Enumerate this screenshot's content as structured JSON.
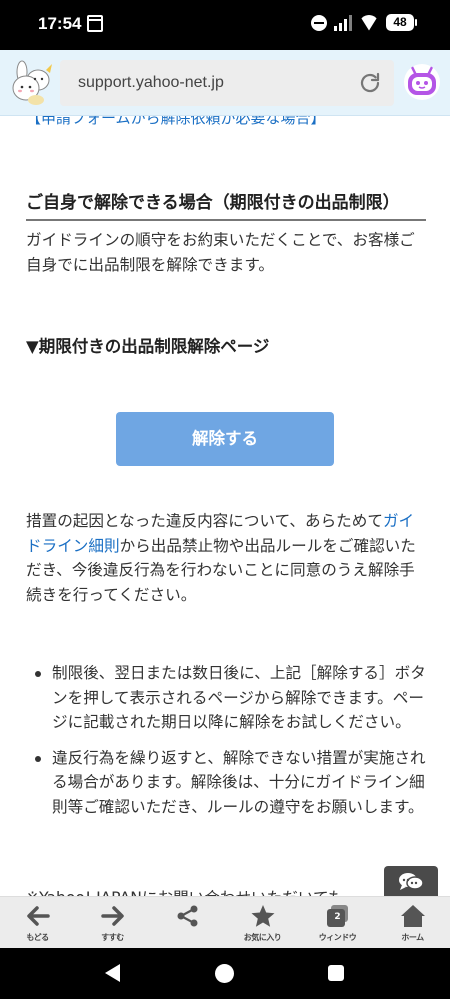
{
  "status": {
    "time": "17:54",
    "battery": "48",
    "icons": [
      "calendar-icon",
      "dnd-icon",
      "signal-icon",
      "wifi-icon",
      "battery-icon"
    ]
  },
  "browser": {
    "url": "support.yahoo-net.jp"
  },
  "content": {
    "cut_link": "【申請フォームから解除依頼が必要な場合】",
    "section_heading": "ご自身で解除できる場合（期限付きの出品制限）",
    "paragraph1": "ガイドラインの順守をお約束いただくことで、お客様ご自身でに出品制限を解除できます。",
    "sub_heading": "▼期限付きの出品制限解除ページ",
    "release_button": "解除する",
    "paragraph2_before": "措置の起因となった違反内容について、あらためて",
    "paragraph2_link": "ガイドライン細則",
    "paragraph2_after": "から出品禁止物や出品ルールをご確認いただき、今後違反行為を行わないことに同意のうえ解除手続きを行ってください。",
    "bullets": [
      "制限後、翌日または数日後に、上記［解除する］ボタンを押して表示されるページから解除できます。ページに記載された期日以降に解除をお試しください。",
      "違反行為を繰り返すと、解除できない措置が実施される場合があります。解除後は、十分にガイドライン細則等ご確認いただき、ルールの遵守をお願いします。"
    ],
    "cut_bottom": "※Yahoo! JAPANにお問い合わせいただいても"
  },
  "toolbar": {
    "items": [
      {
        "label": "もどる",
        "icon": "arrow-left-icon"
      },
      {
        "label": "すすむ",
        "icon": "arrow-right-icon"
      },
      {
        "label": "",
        "icon": "share-icon"
      },
      {
        "label": "お気に入り",
        "icon": "star-icon"
      },
      {
        "label": "ウィンドウ",
        "icon": "window-icon",
        "count": "2"
      },
      {
        "label": "ホーム",
        "icon": "home-icon"
      }
    ]
  }
}
